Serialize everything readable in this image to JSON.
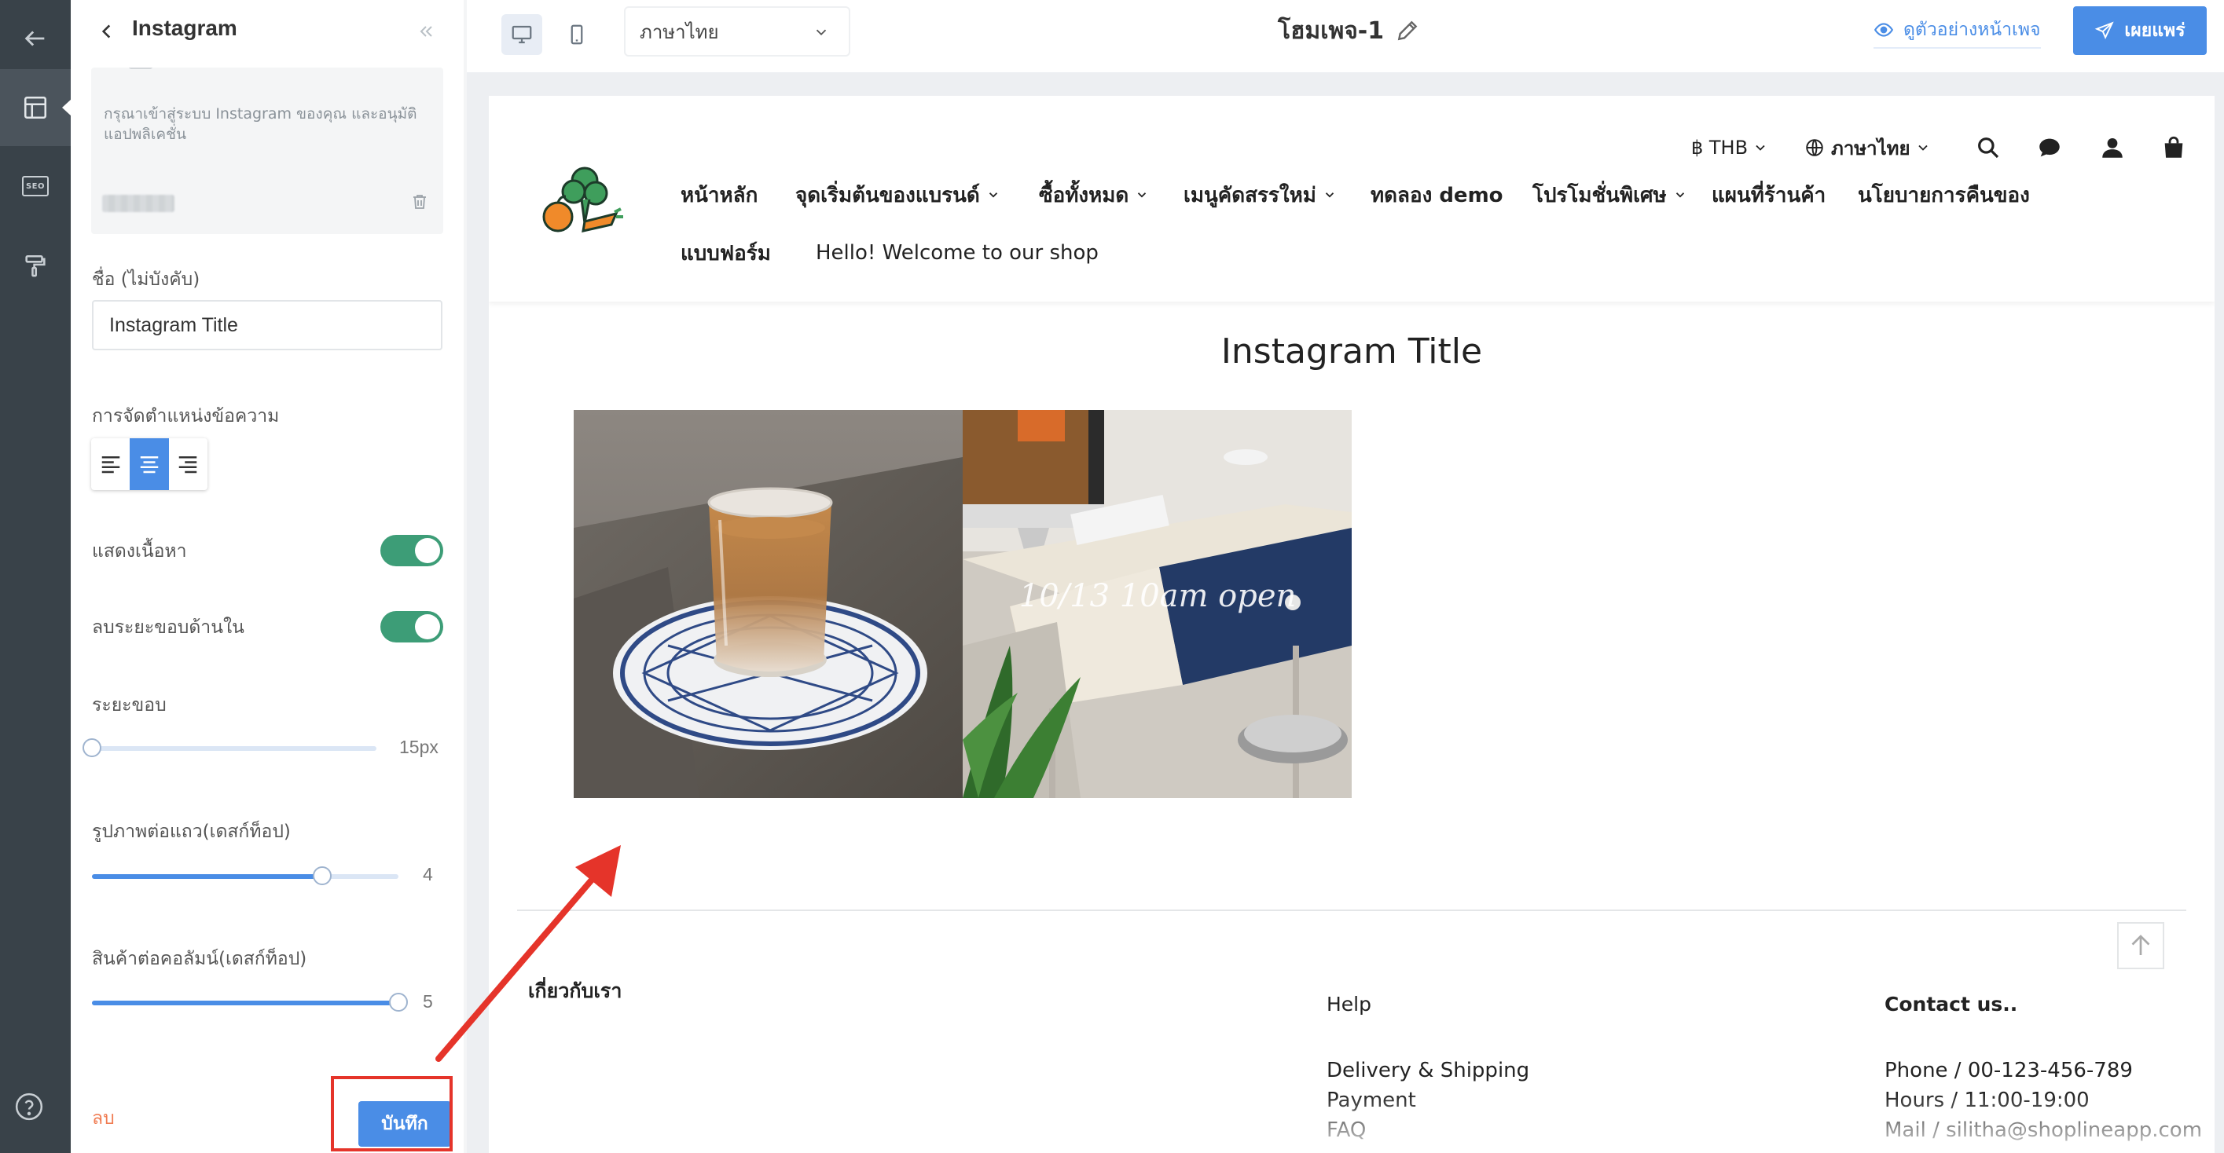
{
  "panel": {
    "title": "Instagram",
    "instagram_notice": "กรุณาเข้าสู่ระบบ Instagram ของคุณ และอนุมัติแอปพลิเคชั่น",
    "name_label": "ชื่อ (ไม่บังคับ)",
    "name_value": "Instagram Title",
    "alignment_label": "การจัดตำแหน่งข้อความ",
    "alignment_selected": "center",
    "show_content_label": "แสดงเนื้อหา",
    "show_content_on": true,
    "remove_inner_padding_label": "ลบระยะขอบด้านใน",
    "remove_inner_padding_on": true,
    "padding_label": "ระยะขอบ",
    "padding_value": "15px",
    "padding_level": 0.0,
    "images_per_row_label": "รูปภาพต่อแถว(เดสก์ท็อป)",
    "images_per_row_value": "4",
    "images_per_row_level": 0.75,
    "products_per_column_label": "สินค้าต่อคอลัมน์(เดสก์ท็อป)",
    "products_per_column_value": "5",
    "products_per_column_level": 1.0,
    "delete_label": "ลบ",
    "save_label": "บันทึก"
  },
  "topbar": {
    "language": "ภาษาไทย",
    "page_title": "โฮมเพจ-1",
    "preview_label": "ดูตัวอย่างหน้าเพจ",
    "publish_label": "เผยแพร่"
  },
  "site": {
    "currency": "฿ THB",
    "language": "ภาษาไทย",
    "nav": [
      {
        "label": "หน้าหลัก"
      },
      {
        "label": "จุดเริ่มต้นของแบรนด์"
      },
      {
        "label": "ซื้อทั้งหมด"
      },
      {
        "label": "เมนูคัดสรรใหม่"
      },
      {
        "label": "ทดลอง demo"
      },
      {
        "label": "โปรโมชั่นพิเศษ"
      },
      {
        "label": "แผนที่ร้านค้า"
      },
      {
        "label": "นโยบายการคืนของ"
      },
      {
        "label": "แบบฟอร์ม"
      },
      {
        "label": "Hello! Welcome to our shop"
      }
    ],
    "instagram_title": "Instagram Title",
    "overlay_text": "10/13 10am open",
    "footer": {
      "about": "เกี่ยวกับเรา",
      "help": "Help",
      "help_links": [
        "Delivery & Shipping",
        "Payment",
        "FAQ"
      ],
      "contact": "Contact us..",
      "contact_lines": [
        "Phone / 00-123-456-789",
        "Hours / 11:00-19:00",
        "Mail / silitha@shoplineapp.com"
      ]
    }
  },
  "colors": {
    "accent": "#4a8de6",
    "toggle_on": "#3d9d77",
    "delete": "#f07c52",
    "annotation": "#e5342a",
    "rail": "#394249"
  }
}
